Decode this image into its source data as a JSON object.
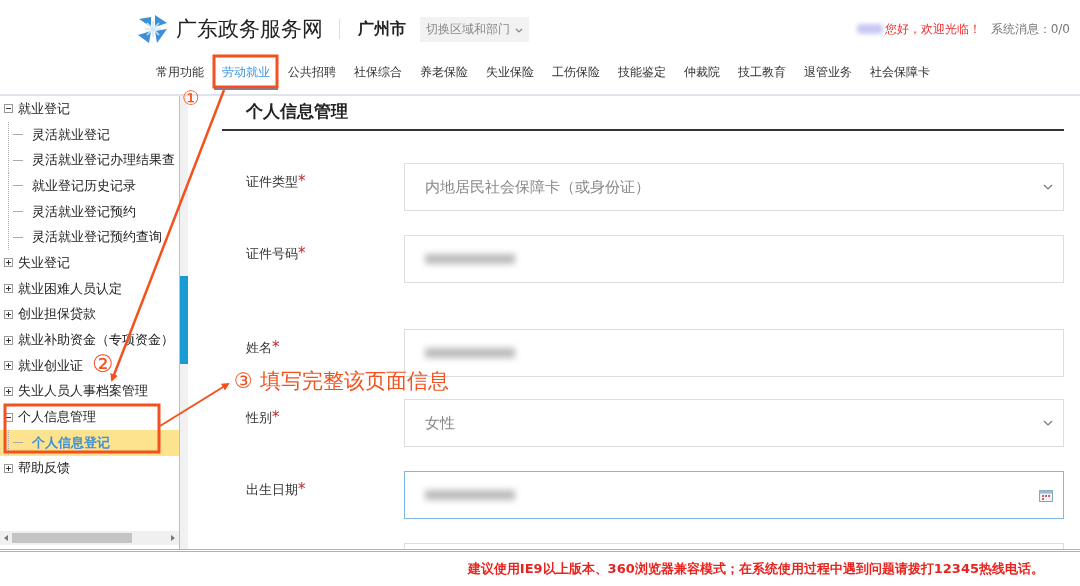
{
  "header": {
    "site_name": "广东政务服务网",
    "city": "广州市",
    "region_selector": "切换区域和部门",
    "greeting": "您好，欢迎光临！",
    "messages": "系统消息：0/0"
  },
  "nav": [
    {
      "label": "常用功能",
      "selected": false
    },
    {
      "label": "劳动就业",
      "selected": true
    },
    {
      "label": "公共招聘",
      "selected": false
    },
    {
      "label": "社保综合",
      "selected": false
    },
    {
      "label": "养老保险",
      "selected": false
    },
    {
      "label": "失业保险",
      "selected": false
    },
    {
      "label": "工伤保险",
      "selected": false
    },
    {
      "label": "技能鉴定",
      "selected": false
    },
    {
      "label": "仲裁院",
      "selected": false
    },
    {
      "label": "技工教育",
      "selected": false
    },
    {
      "label": "退管业务",
      "selected": false
    },
    {
      "label": "社会保障卡",
      "selected": false
    }
  ],
  "sidebar": {
    "tree": [
      {
        "label": "就业登记",
        "expanded": true,
        "children": [
          {
            "label": "灵活就业登记",
            "selected": false
          },
          {
            "label": "灵活就业登记办理结果查",
            "selected": false
          },
          {
            "label": "就业登记历史记录",
            "selected": false
          },
          {
            "label": "灵活就业登记预约",
            "selected": false
          },
          {
            "label": "灵活就业登记预约查询",
            "selected": false
          }
        ]
      },
      {
        "label": "失业登记",
        "expanded": false
      },
      {
        "label": "就业困难人员认定",
        "expanded": false
      },
      {
        "label": "创业担保贷款",
        "expanded": false
      },
      {
        "label": "就业补助资金（专项资金）",
        "expanded": false
      },
      {
        "label": "就业创业证",
        "expanded": false
      },
      {
        "label": "失业人员人事档案管理",
        "expanded": false
      },
      {
        "label": "个人信息管理",
        "expanded": true,
        "children": [
          {
            "label": "个人信息登记",
            "selected": true
          }
        ]
      },
      {
        "label": "帮助反馈",
        "expanded": false
      }
    ]
  },
  "form": {
    "title": "个人信息管理",
    "fields": [
      {
        "label": "证件类型",
        "required_mark": "*",
        "kind": "select",
        "value": "内地居民社会保障卡（或身份证）",
        "focused": false
      },
      {
        "label": "证件号码",
        "required_mark": "*",
        "kind": "text",
        "blurred": true,
        "focused": false
      },
      {
        "label": "姓名",
        "required_mark": "*",
        "kind": "text",
        "blurred": true,
        "focused": false
      },
      {
        "label": "性别",
        "required_mark": "*",
        "kind": "select",
        "value": "女性",
        "focused": false
      },
      {
        "label": "出生日期",
        "required_mark": "*",
        "kind": "date",
        "blurred": true,
        "focused": true
      },
      {
        "kind": "text",
        "focused": false
      }
    ]
  },
  "annotations": [
    {
      "kind": "step",
      "text": "①"
    },
    {
      "kind": "step",
      "text": "②"
    },
    {
      "kind": "step",
      "text": "③ 填写完整该页面信息"
    }
  ],
  "footer": {
    "notice": "建议使用IE9以上版本、360浏览器兼容模式；在系统使用过程中遇到问题请拨打12345热线电话。"
  }
}
